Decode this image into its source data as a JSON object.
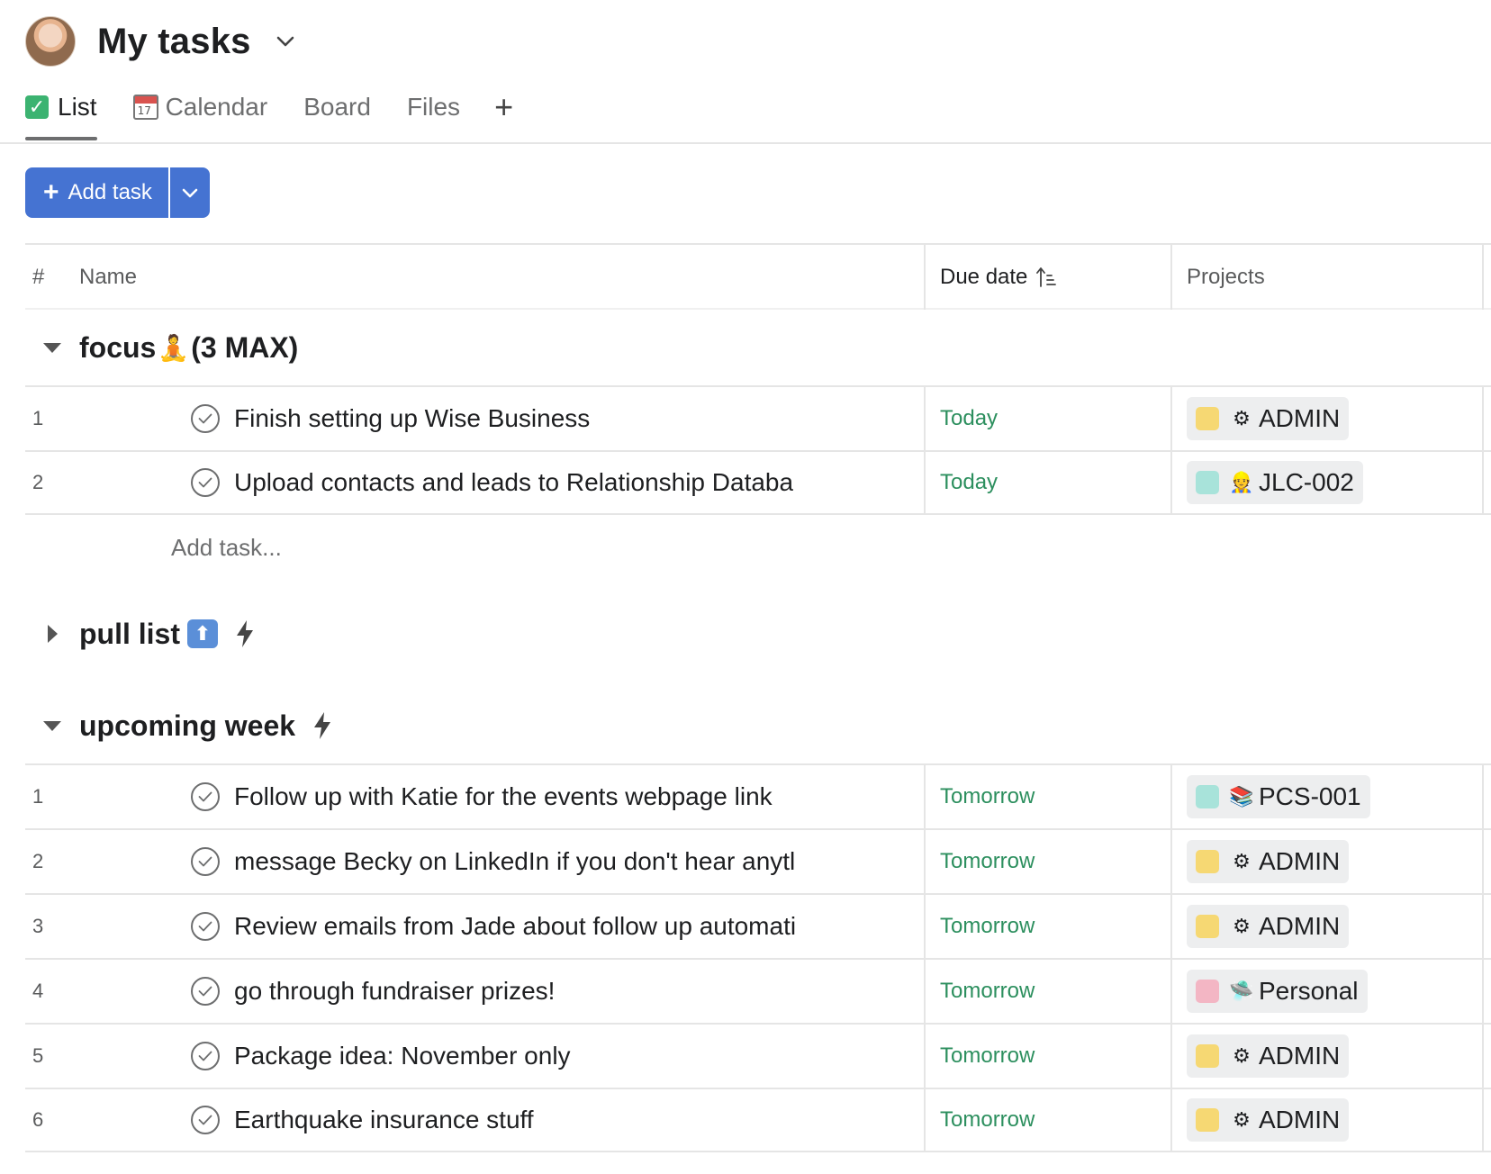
{
  "header": {
    "title": "My tasks"
  },
  "tabs": [
    {
      "label": "List",
      "icon": "checkmark-emoji",
      "active": true
    },
    {
      "label": "Calendar",
      "icon": "calendar-emoji",
      "active": false
    },
    {
      "label": "Board",
      "active": false
    },
    {
      "label": "Files",
      "active": false
    }
  ],
  "toolbar": {
    "add_task_label": "Add task"
  },
  "columns": {
    "num": "#",
    "name": "Name",
    "due": "Due date",
    "projects": "Projects"
  },
  "sections": [
    {
      "title": "focus",
      "title_emoji": "🧘",
      "title_suffix": "(3 MAX)",
      "expanded": true,
      "tasks": [
        {
          "num": "1",
          "name": "Finish setting up Wise Business",
          "due": "Today",
          "project": {
            "label": "ADMIN",
            "color": "#f6d873",
            "icon": "⚙"
          }
        },
        {
          "num": "2",
          "name": "Upload contacts and leads to Relationship Databa",
          "due": "Today",
          "project": {
            "label": "JLC-002",
            "color": "#a8e3da",
            "icon": "👷"
          }
        }
      ],
      "add_task_placeholder": "Add task..."
    },
    {
      "title": "pull list",
      "expanded": false
    },
    {
      "title": "upcoming week",
      "expanded": true,
      "tasks": [
        {
          "num": "1",
          "name": "Follow up with Katie for the events webpage link",
          "due": "Tomorrow",
          "project": {
            "label": "PCS-001",
            "color": "#a8e3da",
            "icon": "📚"
          }
        },
        {
          "num": "2",
          "name": "message Becky on LinkedIn if you don't hear anytl",
          "due": "Tomorrow",
          "project": {
            "label": "ADMIN",
            "color": "#f6d873",
            "icon": "⚙"
          }
        },
        {
          "num": "3",
          "name": "Review emails from Jade about follow up automati",
          "due": "Tomorrow",
          "project": {
            "label": "ADMIN",
            "color": "#f6d873",
            "icon": "⚙"
          }
        },
        {
          "num": "4",
          "name": "go through fundraiser prizes!",
          "due": "Tomorrow",
          "project": {
            "label": "Personal",
            "color": "#f3b6c4",
            "icon": "🛸"
          }
        },
        {
          "num": "5",
          "name": "Package idea: November only",
          "due": "Tomorrow",
          "project": {
            "label": "ADMIN",
            "color": "#f6d873",
            "icon": "⚙"
          }
        },
        {
          "num": "6",
          "name": "Earthquake insurance stuff",
          "due": "Tomorrow",
          "project": {
            "label": "ADMIN",
            "color": "#f6d873",
            "icon": "⚙"
          }
        }
      ]
    }
  ],
  "colors": {
    "accent": "#4573d2",
    "due_green": "#2c8f5e"
  }
}
